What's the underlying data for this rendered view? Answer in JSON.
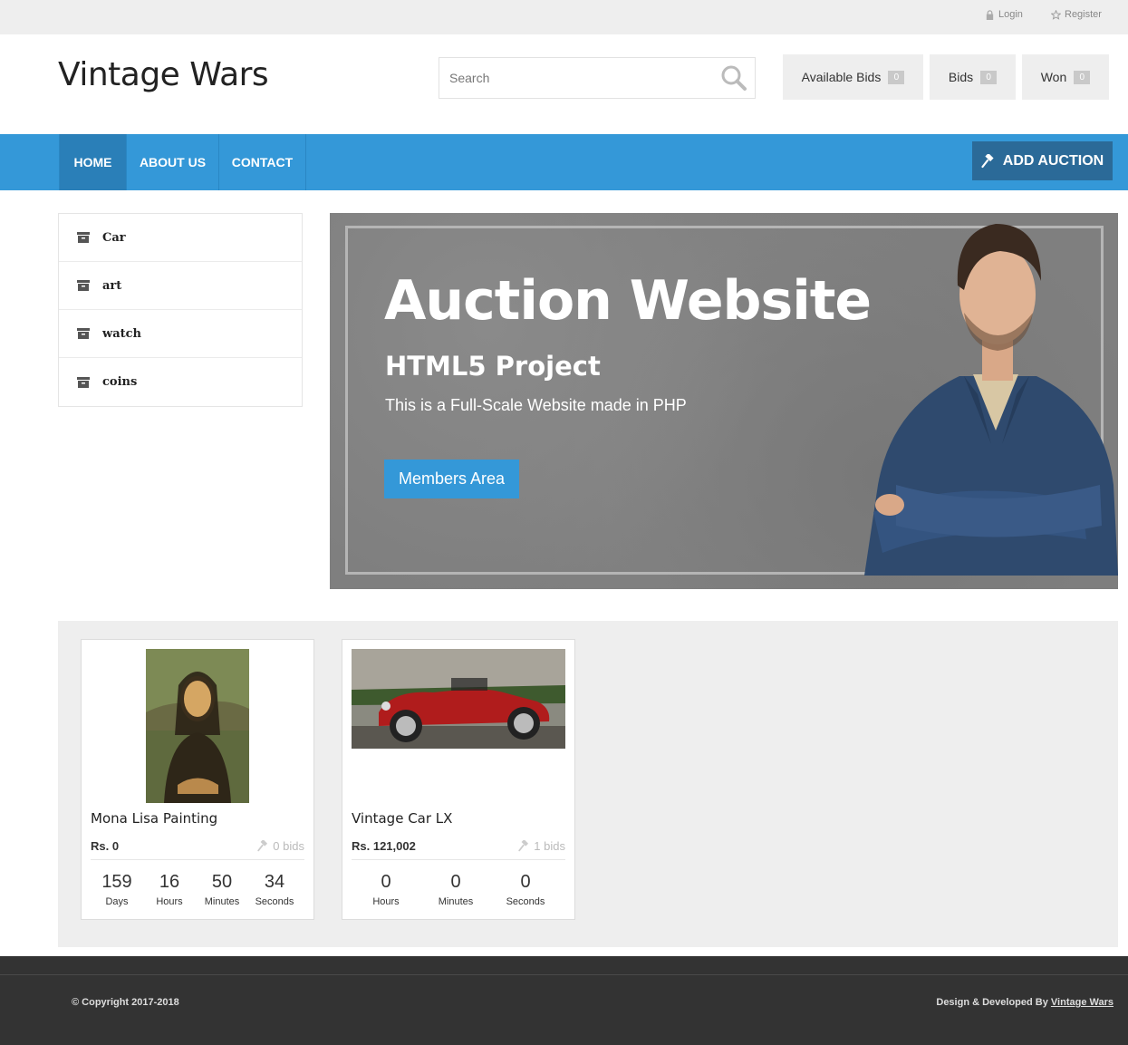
{
  "topbar": {
    "login_label": "Login",
    "register_label": "Register"
  },
  "header": {
    "logo": "Vintage Wars",
    "search_placeholder": "Search",
    "available_bids_label": "Available Bids",
    "available_bids_count": "0",
    "bids_label": "Bids",
    "bids_count": "0",
    "won_label": "Won",
    "won_count": "0"
  },
  "nav": {
    "items": [
      {
        "label": "HOME",
        "active": true
      },
      {
        "label": "ABOUT US",
        "active": false
      },
      {
        "label": "CONTACT",
        "active": false
      }
    ],
    "add_auction_label": "ADD AUCTION"
  },
  "categories": [
    {
      "label": "Car"
    },
    {
      "label": "art"
    },
    {
      "label": "watch"
    },
    {
      "label": "coins"
    }
  ],
  "hero": {
    "title": "Auction Website",
    "subtitle": "HTML5 Project",
    "description": "This is a Full-Scale Website made in PHP",
    "button_label": "Members Area"
  },
  "listings": [
    {
      "title": "Mona Lisa Painting",
      "price": "Rs. 0",
      "bids": "0 bids",
      "countdown": [
        {
          "value": "159",
          "unit": "Days"
        },
        {
          "value": "16",
          "unit": "Hours"
        },
        {
          "value": "50",
          "unit": "Minutes"
        },
        {
          "value": "34",
          "unit": "Seconds"
        }
      ]
    },
    {
      "title": "Vintage Car LX",
      "price": "Rs. 121,002",
      "bids": "1 bids",
      "countdown": [
        {
          "value": "0",
          "unit": "Hours"
        },
        {
          "value": "0",
          "unit": "Minutes"
        },
        {
          "value": "0",
          "unit": "Seconds"
        }
      ]
    }
  ],
  "footer": {
    "copyright": "© Copyright 2017-2018",
    "credit_prefix": "Design & Developed By",
    "credit_link": "Vintage Wars"
  },
  "colors": {
    "accent": "#3498d8",
    "nav_active": "#2a7fb8",
    "add_auction": "#2b6a98",
    "footer": "#333333"
  },
  "icons": {
    "login": "lock-icon",
    "register": "star-outline-icon",
    "search": "search-icon",
    "add_auction": "gavel-icon",
    "category": "archive-box-icon",
    "bids": "gavel-icon"
  }
}
